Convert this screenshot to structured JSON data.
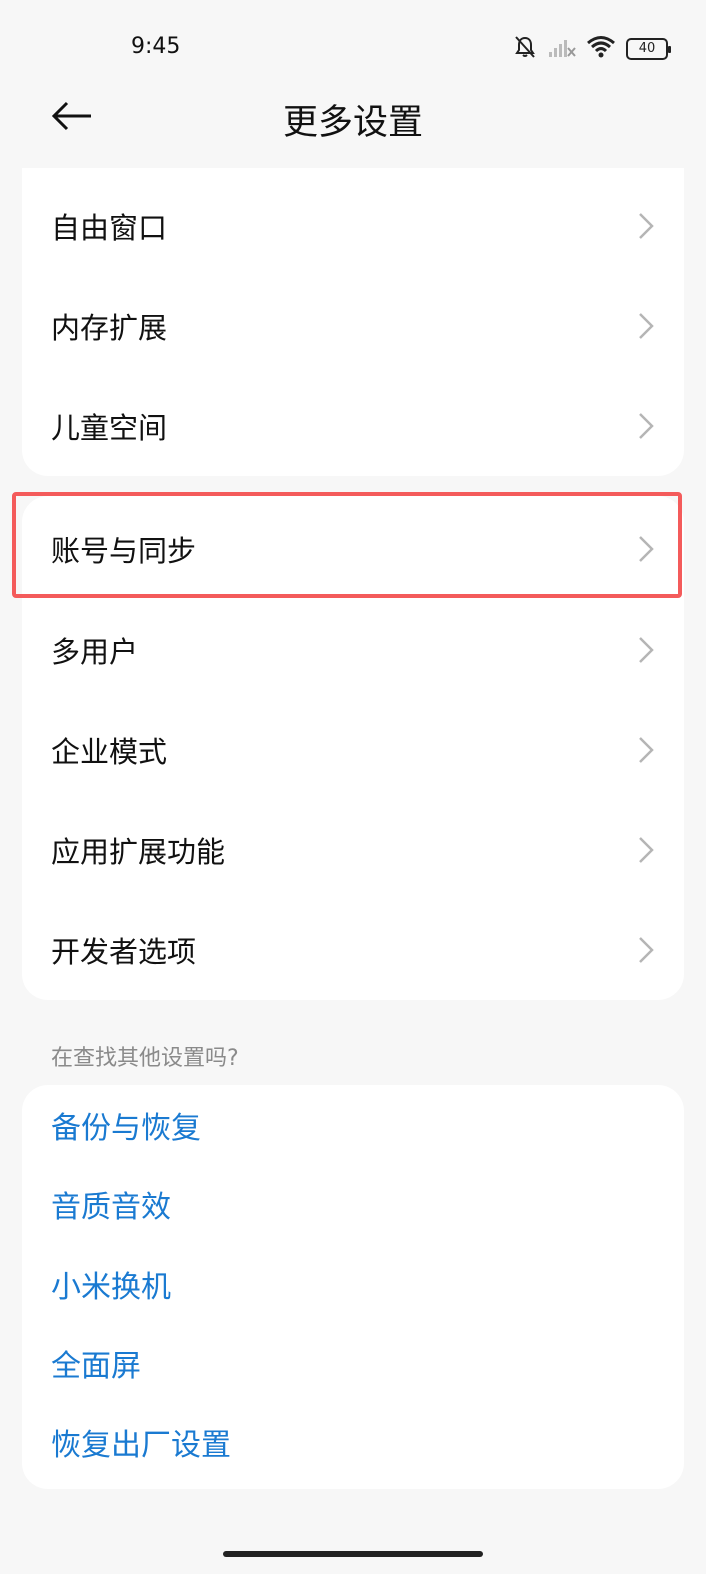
{
  "status_bar": {
    "time": "9:45",
    "battery": "40",
    "icons": [
      "bell-off-icon",
      "signal-icon",
      "wifi-icon",
      "battery-icon"
    ]
  },
  "header": {
    "title": "更多设置",
    "back_icon": "arrow-left-icon"
  },
  "group1": {
    "items": [
      {
        "label": "自由窗口"
      },
      {
        "label": "内存扩展"
      },
      {
        "label": "儿童空间"
      }
    ]
  },
  "group2": {
    "items": [
      {
        "label": "账号与同步"
      },
      {
        "label": "多用户"
      },
      {
        "label": "企业模式"
      },
      {
        "label": "应用扩展功能"
      },
      {
        "label": "开发者选项"
      }
    ]
  },
  "suggestions": {
    "heading": "在查找其他设置吗?",
    "links": [
      {
        "label": "备份与恢复"
      },
      {
        "label": "音质音效"
      },
      {
        "label": "小米换机"
      },
      {
        "label": "全面屏"
      },
      {
        "label": "恢复出厂设置"
      }
    ]
  },
  "colors": {
    "background": "#f7f7f7",
    "card": "#ffffff",
    "link": "#1a7ad1",
    "highlight": "#f45b5b",
    "chevron": "#b5b5b5",
    "hint": "#8a8a8a"
  }
}
